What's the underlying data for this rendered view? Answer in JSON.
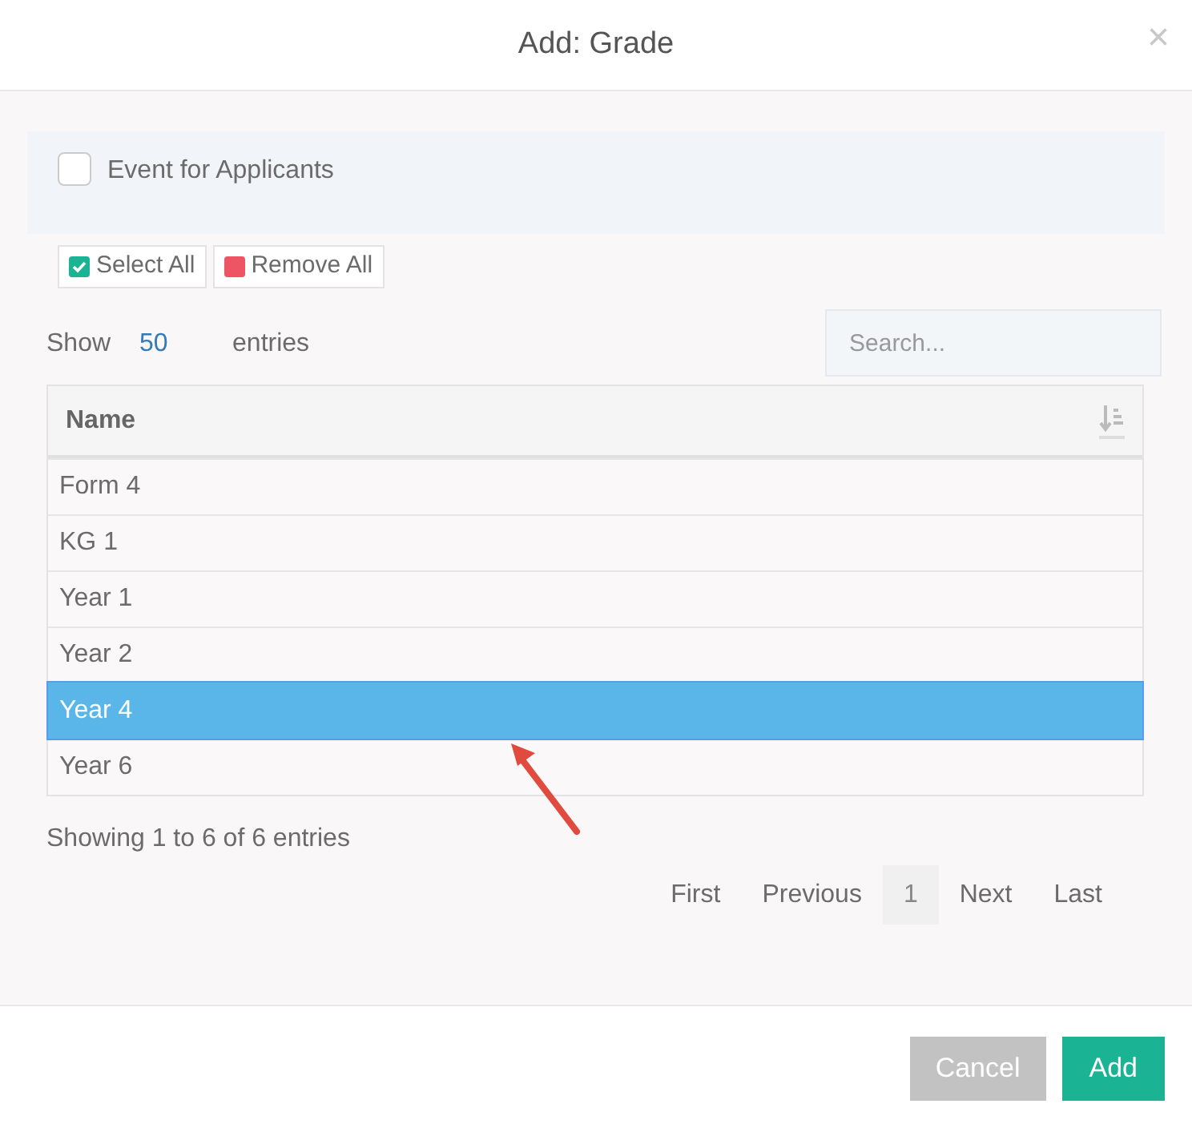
{
  "dialog": {
    "title": "Add: Grade",
    "close": "×"
  },
  "event_option": {
    "label": "Event for Applicants",
    "checked": false
  },
  "bulk_buttons": [
    {
      "label": "Select All",
      "kind": "select"
    },
    {
      "label": "Remove All",
      "kind": "remove"
    }
  ],
  "length": {
    "before": "Show",
    "value": "50",
    "after": "entries"
  },
  "search": {
    "placeholder": "Search..."
  },
  "table": {
    "columns": [
      "Name"
    ],
    "rows": [
      {
        "name": "Form 4",
        "selected": false
      },
      {
        "name": "KG 1",
        "selected": false
      },
      {
        "name": "Year 1",
        "selected": false
      },
      {
        "name": "Year 2",
        "selected": false
      },
      {
        "name": "Year 4",
        "selected": true
      },
      {
        "name": "Year 6",
        "selected": false
      }
    ]
  },
  "info": "Showing 1 to 6 of 6 entries",
  "pagination": [
    {
      "label": "First",
      "selected": false
    },
    {
      "label": "Previous",
      "selected": false
    },
    {
      "label": "1",
      "selected": true
    },
    {
      "label": "Next",
      "selected": false
    },
    {
      "label": "Last",
      "selected": false
    }
  ],
  "footer_buttons": [
    {
      "label": "Cancel",
      "kind": "secondary"
    },
    {
      "label": "Add",
      "kind": "primary"
    }
  ]
}
